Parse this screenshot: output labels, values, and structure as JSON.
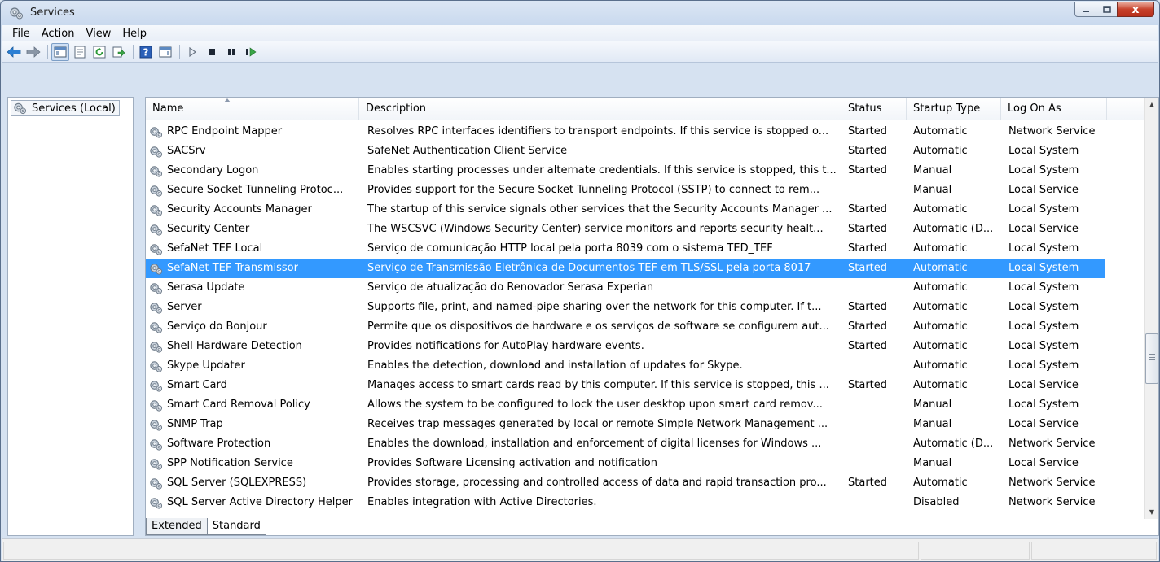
{
  "window": {
    "title": "Services",
    "minimize_icon": "minimize-icon",
    "maximize_icon": "maximize-icon",
    "close_label": "x"
  },
  "menu": [
    "File",
    "Action",
    "View",
    "Help"
  ],
  "toolbar": {
    "buttons": [
      "back-arrow-icon",
      "forward-arrow-icon",
      "show-hide-console-tree-icon",
      "properties-icon",
      "refresh-icon",
      "export-list-icon",
      "help-icon",
      "show-hide-action-pane-icon",
      "start-service-icon",
      "stop-service-icon",
      "pause-service-icon",
      "restart-service-icon"
    ]
  },
  "tree": {
    "root_label": "Services (Local)"
  },
  "columns": [
    "Name",
    "Description",
    "Status",
    "Startup Type",
    "Log On As"
  ],
  "rows": [
    {
      "name": "RPC Endpoint Mapper",
      "description": "Resolves RPC interfaces identifiers to transport endpoints. If this service is stopped o...",
      "status": "Started",
      "startup": "Automatic",
      "logon": "Network Service"
    },
    {
      "name": "SACSrv",
      "description": "SafeNet Authentication Client Service",
      "status": "Started",
      "startup": "Automatic",
      "logon": "Local System"
    },
    {
      "name": "Secondary Logon",
      "description": "Enables starting processes under alternate credentials. If this service is stopped, this t...",
      "status": "Started",
      "startup": "Manual",
      "logon": "Local System"
    },
    {
      "name": "Secure Socket Tunneling Protoc...",
      "description": "Provides support for the Secure Socket Tunneling Protocol (SSTP) to connect to rem...",
      "status": "",
      "startup": "Manual",
      "logon": "Local Service"
    },
    {
      "name": "Security Accounts Manager",
      "description": "The startup of this service signals other services that the Security Accounts Manager ...",
      "status": "Started",
      "startup": "Automatic",
      "logon": "Local System"
    },
    {
      "name": "Security Center",
      "description": "The WSCSVC (Windows Security Center) service monitors and reports security healt...",
      "status": "Started",
      "startup": "Automatic (D...",
      "logon": "Local Service"
    },
    {
      "name": "SefaNet TEF Local",
      "description": "Serviço de comunicação HTTP local pela porta 8039 com o sistema TED_TEF",
      "status": "Started",
      "startup": "Automatic",
      "logon": "Local System"
    },
    {
      "name": "SefaNet TEF Transmissor",
      "description": "Serviço de Transmissão Eletrônica de Documentos TEF em TLS/SSL pela porta 8017",
      "status": "Started",
      "startup": "Automatic",
      "logon": "Local System",
      "selected": true
    },
    {
      "name": "Serasa Update",
      "description": "Serviço de atualização do Renovador Serasa Experian",
      "status": "",
      "startup": "Automatic",
      "logon": "Local System"
    },
    {
      "name": "Server",
      "description": "Supports file, print, and named-pipe sharing over the network for this computer. If t...",
      "status": "Started",
      "startup": "Automatic",
      "logon": "Local System"
    },
    {
      "name": "Serviço do Bonjour",
      "description": "Permite que os dispositivos de hardware e os serviços de software se configurem aut...",
      "status": "Started",
      "startup": "Automatic",
      "logon": "Local System"
    },
    {
      "name": "Shell Hardware Detection",
      "description": "Provides notifications for AutoPlay hardware events.",
      "status": "Started",
      "startup": "Automatic",
      "logon": "Local System"
    },
    {
      "name": "Skype Updater",
      "description": "Enables the detection, download and installation of updates for Skype.",
      "status": "",
      "startup": "Automatic",
      "logon": "Local System"
    },
    {
      "name": "Smart Card",
      "description": "Manages access to smart cards read by this computer. If this service is stopped, this ...",
      "status": "Started",
      "startup": "Automatic",
      "logon": "Local Service"
    },
    {
      "name": "Smart Card Removal Policy",
      "description": "Allows the system to be configured to lock the user desktop upon smart card remov...",
      "status": "",
      "startup": "Manual",
      "logon": "Local System"
    },
    {
      "name": "SNMP Trap",
      "description": "Receives trap messages generated by local or remote Simple Network Management ...",
      "status": "",
      "startup": "Manual",
      "logon": "Local Service"
    },
    {
      "name": "Software Protection",
      "description": "Enables the download, installation and enforcement of digital licenses for Windows ...",
      "status": "",
      "startup": "Automatic (D...",
      "logon": "Network Service"
    },
    {
      "name": "SPP Notification Service",
      "description": "Provides Software Licensing activation and notification",
      "status": "",
      "startup": "Manual",
      "logon": "Local Service"
    },
    {
      "name": "SQL Server (SQLEXPRESS)",
      "description": "Provides storage, processing and controlled access of data and rapid transaction pro...",
      "status": "Started",
      "startup": "Automatic",
      "logon": "Network Service"
    },
    {
      "name": "SQL Server Active Directory Helper",
      "description": "Enables integration with Active Directories.",
      "status": "",
      "startup": "Disabled",
      "logon": "Network Service"
    }
  ],
  "tabs": [
    "Extended",
    "Standard"
  ],
  "active_tab": "Standard",
  "colors": {
    "selection": "#3399ff",
    "close_button": "#c7412b"
  }
}
